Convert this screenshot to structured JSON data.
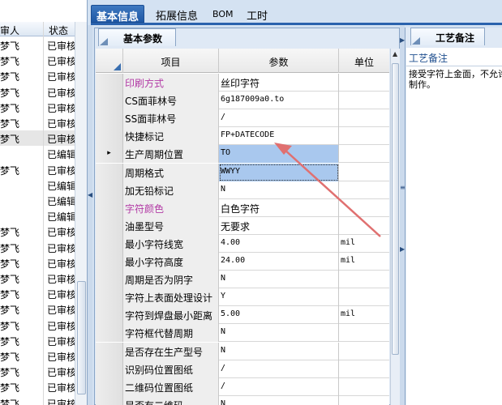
{
  "top_tabs": [
    {
      "label": "基本信息",
      "active": true
    },
    {
      "label": "拓展信息",
      "active": false
    },
    {
      "label": "BOM",
      "active": false
    },
    {
      "label": "工时",
      "active": false
    }
  ],
  "left_list": {
    "headers": [
      "审人",
      "状态"
    ],
    "rows": [
      {
        "c1": "梦飞",
        "c2": "已审核"
      },
      {
        "c1": "梦飞",
        "c2": "已审核"
      },
      {
        "c1": "梦飞",
        "c2": "已审核"
      },
      {
        "c1": "梦飞",
        "c2": "已审核"
      },
      {
        "c1": "梦飞",
        "c2": "已审核"
      },
      {
        "c1": "梦飞",
        "c2": "已审核"
      },
      {
        "c1": "梦飞",
        "c2": "已审核"
      },
      {
        "c1": "",
        "c2": "已编辑"
      },
      {
        "c1": "梦飞",
        "c2": "已审核"
      },
      {
        "c1": "",
        "c2": "已编辑"
      },
      {
        "c1": "",
        "c2": "已编辑"
      },
      {
        "c1": "",
        "c2": "已编辑"
      },
      {
        "c1": "梦飞",
        "c2": "已审核"
      },
      {
        "c1": "梦飞",
        "c2": "已审核"
      },
      {
        "c1": "梦飞",
        "c2": "已审核"
      },
      {
        "c1": "梦飞",
        "c2": "已审核"
      },
      {
        "c1": "梦飞",
        "c2": "已审核"
      },
      {
        "c1": "梦飞",
        "c2": "已审核"
      },
      {
        "c1": "梦飞",
        "c2": "已审核"
      },
      {
        "c1": "梦飞",
        "c2": "已审核"
      },
      {
        "c1": "梦飞",
        "c2": "已审核"
      },
      {
        "c1": "梦飞",
        "c2": "已审核"
      },
      {
        "c1": "梦飞",
        "c2": "已审核"
      },
      {
        "c1": "梦飞",
        "c2": "已审核"
      }
    ],
    "selected_row": 6
  },
  "params_panel": {
    "tab_label": "基本参数",
    "columns": [
      "项目",
      "参数",
      "单位"
    ],
    "rows": [
      {
        "name": "印刷方式",
        "value": "丝印字符",
        "unit": "",
        "name_pink": true,
        "value_cjk": true
      },
      {
        "name": "CS面菲林号",
        "value": "6g187009a0.to",
        "unit": ""
      },
      {
        "name": "SS面菲林号",
        "value": "/",
        "unit": ""
      },
      {
        "name": "快捷标记",
        "value": "FP+DATECODE",
        "unit": ""
      },
      {
        "name": "生产周期位置",
        "value": "TO",
        "unit": "",
        "indicator": "▸",
        "selected": "sel"
      },
      {
        "name": "周期格式",
        "value": "WWYY",
        "unit": "",
        "selected": "sel2"
      },
      {
        "name": "加无铅标记",
        "value": "N",
        "unit": ""
      },
      {
        "name": "字符颜色",
        "value": "白色字符",
        "unit": "",
        "name_pink": true,
        "value_cjk": true
      },
      {
        "name": "油墨型号",
        "value": "无要求",
        "unit": "",
        "value_cjk": true
      },
      {
        "name": "最小字符线宽",
        "value": "4.00",
        "unit": "mil"
      },
      {
        "name": "最小字符高度",
        "value": "24.00",
        "unit": "mil"
      },
      {
        "name": "周期是否为阴字",
        "value": "N",
        "unit": ""
      },
      {
        "name": "字符上表面处理设计",
        "value": "Y",
        "unit": ""
      },
      {
        "name": "字符到焊盘最小距离",
        "value": "5.00",
        "unit": "mil"
      },
      {
        "name": "字符框代替周期",
        "value": "N",
        "unit": ""
      },
      {
        "name": "是否存在生产型号",
        "value": "N",
        "unit": ""
      },
      {
        "name": "识别码位置图纸",
        "value": "/",
        "unit": ""
      },
      {
        "name": "二维码位置图纸",
        "value": "/",
        "unit": ""
      },
      {
        "name": "是否有二维码",
        "value": "N",
        "unit": ""
      }
    ]
  },
  "remark_panel": {
    "tab_label": "工艺备注",
    "title": "工艺备注",
    "text": "接受字符上金面，不允许\n制作。"
  },
  "colors": {
    "accent": "#2a62ad",
    "selection": "#a9c8ee",
    "pink_label": "#b23aa5",
    "annotation_arrow": "#e07070"
  },
  "icons": {
    "row_indicator": "play-triangle-icon",
    "annotation": "arrow-icon"
  }
}
